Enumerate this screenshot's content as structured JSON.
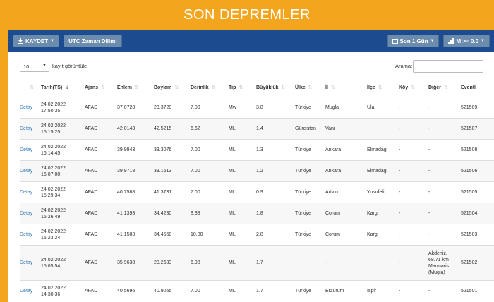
{
  "header": {
    "title": "SON DEPREMLER"
  },
  "toolbar": {
    "save_label": "KAYDET",
    "utc_label": "UTC Zaman Dilimi",
    "period_label": "Son 1 Gün",
    "magnitude_label": "M >= 0.0"
  },
  "controls": {
    "page_length_value": "10",
    "page_length_label": "kayıt görüntüle",
    "search_label": "Arama:",
    "search_value": ""
  },
  "table": {
    "columns": [
      "",
      "Tarih(TS)",
      "Ajans",
      "Enlem",
      "Boylam",
      "Derinlik",
      "Tip",
      "Büyüklük",
      "Ülke",
      "İl",
      "İlçe",
      "Köy",
      "Diğer",
      "Eventl"
    ],
    "rows": [
      {
        "link": "Detay",
        "date": "24.02.2022",
        "time": "17:50:35",
        "agency": "AFAD",
        "lat": "37.0728",
        "lon": "28.3720",
        "depth": "7.00",
        "type": "Mw",
        "mag": "3.8",
        "country": "Türkiye",
        "city": "Mugla",
        "district": "Ula",
        "village": "-",
        "other": "-",
        "event": "521509"
      },
      {
        "link": "Detay",
        "date": "24.02.2022",
        "time": "16:15:25",
        "agency": "AFAD",
        "lat": "42.0143",
        "lon": "42.5215",
        "depth": "6.62",
        "type": "ML",
        "mag": "1.4",
        "country": "Gürcistan",
        "city": "Vani",
        "district": "-",
        "village": "-",
        "other": "-",
        "event": "521507"
      },
      {
        "link": "Detay",
        "date": "24.02.2022",
        "time": "16:14:45",
        "agency": "AFAD",
        "lat": "39.9943",
        "lon": "33.3076",
        "depth": "7.00",
        "type": "ML",
        "mag": "1.3",
        "country": "Türkiye",
        "city": "Ankara",
        "district": "Elmadag",
        "village": "-",
        "other": "-",
        "event": "521508"
      },
      {
        "link": "Detay",
        "date": "24.02.2022",
        "time": "16:07:00",
        "agency": "AFAD",
        "lat": "39.9718",
        "lon": "33.1613",
        "depth": "7.00",
        "type": "ML",
        "mag": "1.2",
        "country": "Türkiye",
        "city": "Ankara",
        "district": "Elmadag",
        "village": "-",
        "other": "-",
        "event": "521506"
      },
      {
        "link": "Detay",
        "date": "24.02.2022",
        "time": "15:29:34",
        "agency": "AFAD",
        "lat": "40.7588",
        "lon": "41.3731",
        "depth": "7.00",
        "type": "ML",
        "mag": "0.9",
        "country": "Türkiye",
        "city": "Artvin",
        "district": "Yusufeli",
        "village": "-",
        "other": "-",
        "event": "521505"
      },
      {
        "link": "Detay",
        "date": "24.02.2022",
        "time": "15:26:49",
        "agency": "AFAD",
        "lat": "41.1393",
        "lon": "34.4230",
        "depth": "8.33",
        "type": "ML",
        "mag": "1.8",
        "country": "Türkiye",
        "city": "Çorum",
        "district": "Kargi",
        "village": "-",
        "other": "-",
        "event": "521504"
      },
      {
        "link": "Detay",
        "date": "24.02.2022",
        "time": "15:23:24",
        "agency": "AFAD",
        "lat": "41.1583",
        "lon": "34.4568",
        "depth": "10.80",
        "type": "ML",
        "mag": "2.8",
        "country": "Türkiye",
        "city": "Çorum",
        "district": "Kargi",
        "village": "-",
        "other": "-",
        "event": "521503"
      },
      {
        "link": "Detay",
        "date": "24.02.2022",
        "time": "15:05:54",
        "agency": "AFAD",
        "lat": "35.9638",
        "lon": "28.2633",
        "depth": "6.98",
        "type": "ML",
        "mag": "1.7",
        "country": "-",
        "city": "-",
        "district": "-",
        "village": "-",
        "other": "Akdeniz, 68.71 km Marmaris (Mugla)",
        "event": "521502"
      },
      {
        "link": "Detay",
        "date": "24.02.2022",
        "time": "14:30:36",
        "agency": "AFAD",
        "lat": "40.5696",
        "lon": "40.9055",
        "depth": "7.00",
        "type": "ML",
        "mag": "1.7",
        "country": "Türkiye",
        "city": "Erzurum",
        "district": "Ispir",
        "village": "-",
        "other": "-",
        "event": "521501"
      }
    ]
  }
}
